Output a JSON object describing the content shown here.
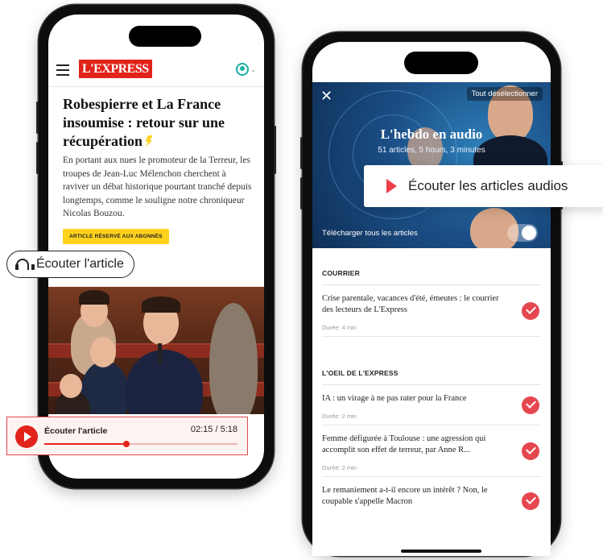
{
  "phone1": {
    "brand_logo": "L'EXPRESS",
    "headline": "Robespierre et La France insoumise : retour sur une récupération",
    "lead": "En portant aux nues le promoteur de la Terreur, les troupes de Jean-Luc Mélenchon cherchent à raviver un débat historique pourtant tranché depuis longtemps, comme le souligne notre chroniqueur Nicolas Bouzou.",
    "subscriber_badge": "ARTICLE RÉSERVÉ AUX ABONNÉS"
  },
  "listen_button": {
    "label": "Écouter l'article",
    "icon": "headphones-icon"
  },
  "player": {
    "title": "Écouter l'article",
    "time": "02:15 / 5:18",
    "progress_fraction": 0.425
  },
  "phone2": {
    "close_icon": "close-icon",
    "deselect_label": "Tout désélectionner",
    "hebdo_title": "L'hebdo en audio",
    "hebdo_subtitle": "51 articles, 5 hours, 3 minutes",
    "download_all_label": "Télécharger tous les articles",
    "sections": [
      {
        "heading": "COURRIER",
        "items": [
          {
            "title": "Crise parentale, vacances d'été, émeutes : le courrier des lecteurs de L'Express",
            "duration": "Durée: 4 min"
          }
        ]
      },
      {
        "heading": "L'OEIL DE L'EXPRESS",
        "items": [
          {
            "title": "IA : un virage à ne pas rater pour la France",
            "duration": "Durée: 2 min"
          },
          {
            "title": "Femme défigurée à Toulouse : une agression qui accomplit son effet de terreur, par Anne R...",
            "duration": "Durée: 2 min"
          },
          {
            "title": "Le remaniement a-t-il encore un intérêt ? Non, le coupable s'appelle Macron",
            "duration": ""
          }
        ]
      }
    ]
  },
  "audio_callout": {
    "label": "Écouter les articles audios"
  },
  "colors": {
    "brand_red": "#e2231a",
    "accent_yellow": "#ffd21e",
    "check_red": "#e5474f",
    "teal": "#1ab0a5"
  }
}
